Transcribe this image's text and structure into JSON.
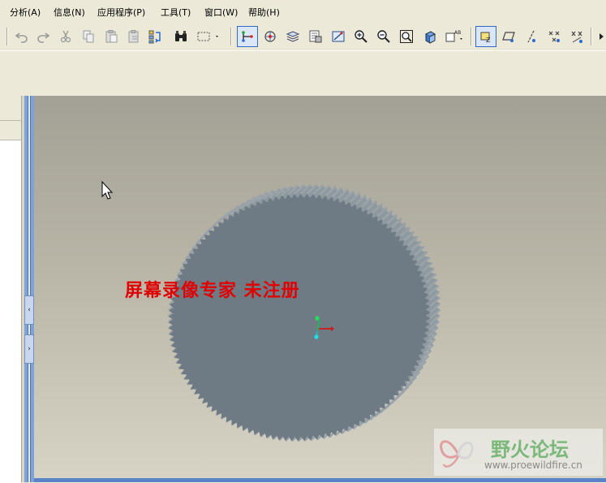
{
  "menubar": {
    "items": [
      "分析(A)",
      "信息(N)",
      "应用程序(P)",
      "工具(T)",
      "窗口(W)",
      "帮助(H)"
    ]
  },
  "toolbar": {
    "buttons": [
      "undo-icon",
      "redo-icon",
      "cut-icon",
      "copy-icon",
      "paste-icon",
      "paste-special-icon",
      "regenerate-icon",
      "find-icon",
      "select-box-icon",
      "datum-axis-display-icon",
      "spin-center-icon",
      "layers-icon",
      "saved-views-icon",
      "repaint-icon",
      "zoom-in-icon",
      "zoom-out-icon",
      "refit-icon",
      "orient-icon",
      "named-view-icon",
      "datum-plane-display-icon",
      "datum-plane-icon",
      "datum-axis-icon",
      "datum-point-icon",
      "coordinate-system-icon",
      "more-icon"
    ],
    "active": [
      "datum-axis-display-icon",
      "datum-plane-display-icon"
    ]
  },
  "viewport": {
    "watermark_text": "屏幕录像专家  未注册",
    "logo_title": "野火论坛",
    "logo_url": "www.proewildfire.cn",
    "colors": {
      "gear_face": "#6f7b84",
      "gear_teeth": "#9aa3aa",
      "background_top": "#a3a195",
      "background_bottom": "#d7d4c6",
      "watermark": "#e00000"
    }
  }
}
